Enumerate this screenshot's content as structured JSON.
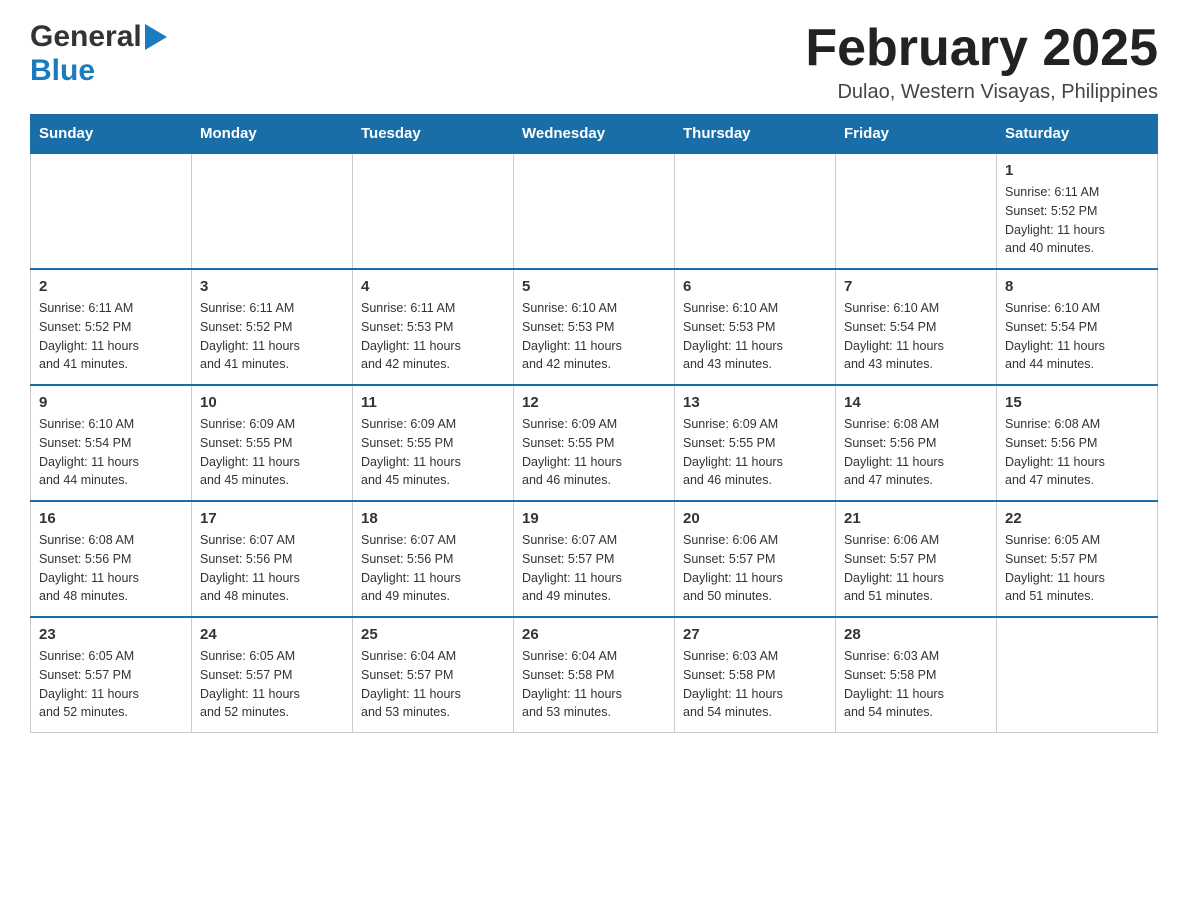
{
  "header": {
    "logo_general": "General",
    "logo_blue": "Blue",
    "month_title": "February 2025",
    "location": "Dulao, Western Visayas, Philippines"
  },
  "calendar": {
    "days_of_week": [
      "Sunday",
      "Monday",
      "Tuesday",
      "Wednesday",
      "Thursday",
      "Friday",
      "Saturday"
    ],
    "weeks": [
      {
        "days": [
          {
            "date": "",
            "info": ""
          },
          {
            "date": "",
            "info": ""
          },
          {
            "date": "",
            "info": ""
          },
          {
            "date": "",
            "info": ""
          },
          {
            "date": "",
            "info": ""
          },
          {
            "date": "",
            "info": ""
          },
          {
            "date": "1",
            "info": "Sunrise: 6:11 AM\nSunset: 5:52 PM\nDaylight: 11 hours\nand 40 minutes."
          }
        ]
      },
      {
        "days": [
          {
            "date": "2",
            "info": "Sunrise: 6:11 AM\nSunset: 5:52 PM\nDaylight: 11 hours\nand 41 minutes."
          },
          {
            "date": "3",
            "info": "Sunrise: 6:11 AM\nSunset: 5:52 PM\nDaylight: 11 hours\nand 41 minutes."
          },
          {
            "date": "4",
            "info": "Sunrise: 6:11 AM\nSunset: 5:53 PM\nDaylight: 11 hours\nand 42 minutes."
          },
          {
            "date": "5",
            "info": "Sunrise: 6:10 AM\nSunset: 5:53 PM\nDaylight: 11 hours\nand 42 minutes."
          },
          {
            "date": "6",
            "info": "Sunrise: 6:10 AM\nSunset: 5:53 PM\nDaylight: 11 hours\nand 43 minutes."
          },
          {
            "date": "7",
            "info": "Sunrise: 6:10 AM\nSunset: 5:54 PM\nDaylight: 11 hours\nand 43 minutes."
          },
          {
            "date": "8",
            "info": "Sunrise: 6:10 AM\nSunset: 5:54 PM\nDaylight: 11 hours\nand 44 minutes."
          }
        ]
      },
      {
        "days": [
          {
            "date": "9",
            "info": "Sunrise: 6:10 AM\nSunset: 5:54 PM\nDaylight: 11 hours\nand 44 minutes."
          },
          {
            "date": "10",
            "info": "Sunrise: 6:09 AM\nSunset: 5:55 PM\nDaylight: 11 hours\nand 45 minutes."
          },
          {
            "date": "11",
            "info": "Sunrise: 6:09 AM\nSunset: 5:55 PM\nDaylight: 11 hours\nand 45 minutes."
          },
          {
            "date": "12",
            "info": "Sunrise: 6:09 AM\nSunset: 5:55 PM\nDaylight: 11 hours\nand 46 minutes."
          },
          {
            "date": "13",
            "info": "Sunrise: 6:09 AM\nSunset: 5:55 PM\nDaylight: 11 hours\nand 46 minutes."
          },
          {
            "date": "14",
            "info": "Sunrise: 6:08 AM\nSunset: 5:56 PM\nDaylight: 11 hours\nand 47 minutes."
          },
          {
            "date": "15",
            "info": "Sunrise: 6:08 AM\nSunset: 5:56 PM\nDaylight: 11 hours\nand 47 minutes."
          }
        ]
      },
      {
        "days": [
          {
            "date": "16",
            "info": "Sunrise: 6:08 AM\nSunset: 5:56 PM\nDaylight: 11 hours\nand 48 minutes."
          },
          {
            "date": "17",
            "info": "Sunrise: 6:07 AM\nSunset: 5:56 PM\nDaylight: 11 hours\nand 48 minutes."
          },
          {
            "date": "18",
            "info": "Sunrise: 6:07 AM\nSunset: 5:56 PM\nDaylight: 11 hours\nand 49 minutes."
          },
          {
            "date": "19",
            "info": "Sunrise: 6:07 AM\nSunset: 5:57 PM\nDaylight: 11 hours\nand 49 minutes."
          },
          {
            "date": "20",
            "info": "Sunrise: 6:06 AM\nSunset: 5:57 PM\nDaylight: 11 hours\nand 50 minutes."
          },
          {
            "date": "21",
            "info": "Sunrise: 6:06 AM\nSunset: 5:57 PM\nDaylight: 11 hours\nand 51 minutes."
          },
          {
            "date": "22",
            "info": "Sunrise: 6:05 AM\nSunset: 5:57 PM\nDaylight: 11 hours\nand 51 minutes."
          }
        ]
      },
      {
        "days": [
          {
            "date": "23",
            "info": "Sunrise: 6:05 AM\nSunset: 5:57 PM\nDaylight: 11 hours\nand 52 minutes."
          },
          {
            "date": "24",
            "info": "Sunrise: 6:05 AM\nSunset: 5:57 PM\nDaylight: 11 hours\nand 52 minutes."
          },
          {
            "date": "25",
            "info": "Sunrise: 6:04 AM\nSunset: 5:57 PM\nDaylight: 11 hours\nand 53 minutes."
          },
          {
            "date": "26",
            "info": "Sunrise: 6:04 AM\nSunset: 5:58 PM\nDaylight: 11 hours\nand 53 minutes."
          },
          {
            "date": "27",
            "info": "Sunrise: 6:03 AM\nSunset: 5:58 PM\nDaylight: 11 hours\nand 54 minutes."
          },
          {
            "date": "28",
            "info": "Sunrise: 6:03 AM\nSunset: 5:58 PM\nDaylight: 11 hours\nand 54 minutes."
          },
          {
            "date": "",
            "info": ""
          }
        ]
      }
    ]
  }
}
